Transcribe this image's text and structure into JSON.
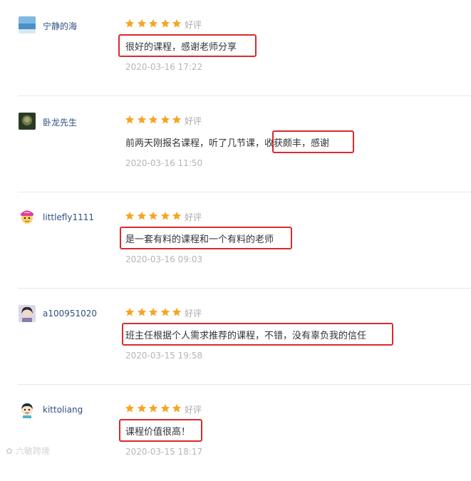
{
  "reviews": [
    {
      "username": "宁静的海",
      "avatar_icon": "sea-avatar-icon",
      "rating": 5,
      "rating_label": "好评",
      "comment": "很好的课程，感谢老师分享",
      "date": "2020-03-16 17:22"
    },
    {
      "username": "卧龙先生",
      "avatar_icon": "dark-portrait-avatar-icon",
      "rating": 5,
      "rating_label": "好评",
      "comment": "前两天刚报名课程，听了几节课，收获颇丰，感谢",
      "date": "2020-03-16 11:50"
    },
    {
      "username": "littlefly1111",
      "avatar_icon": "cartoon-girl-avatar-icon",
      "rating": 5,
      "rating_label": "好评",
      "comment": "是一套有料的课程和一个有料的老师",
      "date": "2020-03-16 09:03"
    },
    {
      "username": "a100951020",
      "avatar_icon": "photo-person-avatar-icon",
      "rating": 5,
      "rating_label": "好评",
      "comment": "班主任根据个人需求推荐的课程，不错，没有辜负我的信任",
      "date": "2020-03-15 19:58"
    },
    {
      "username": "kittoliang",
      "avatar_icon": "cartoon-boy-avatar-icon",
      "rating": 5,
      "rating_label": "好评",
      "comment": "课程价值很高！",
      "date": "2020-03-15 18:17"
    }
  ],
  "colors": {
    "star": "#f5a623",
    "highlight_border": "#d92b2b",
    "username": "#2f4f7f"
  },
  "watermark": {
    "text": "六敏跨境"
  }
}
